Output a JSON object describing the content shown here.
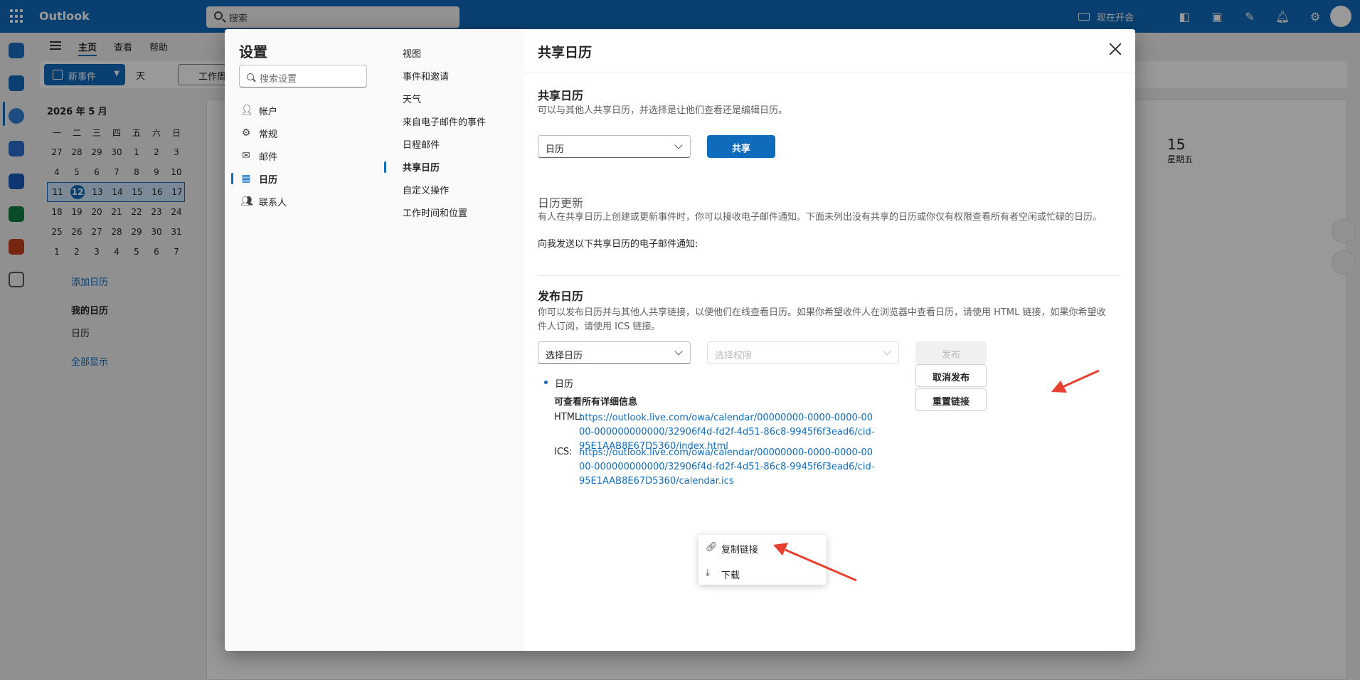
{
  "app": {
    "brand": "Outlook",
    "search_placeholder": "搜索",
    "meet_now": "现在开会"
  },
  "ribbon": {
    "tabs": [
      "主页",
      "查看",
      "帮助"
    ],
    "new_event": "新事件",
    "view_day": "天",
    "view_workweek": "工作周"
  },
  "mini_calendar": {
    "header": "2026 年 5 月",
    "weekdays": [
      "一",
      "二",
      "三",
      "四",
      "五",
      "六",
      "日"
    ],
    "weeks": [
      [
        "27",
        "28",
        "29",
        "30",
        "1",
        "2",
        "3"
      ],
      [
        "4",
        "5",
        "6",
        "7",
        "8",
        "9",
        "10"
      ],
      [
        "11",
        "12",
        "13",
        "14",
        "15",
        "16",
        "17"
      ],
      [
        "18",
        "19",
        "20",
        "21",
        "22",
        "23",
        "24"
      ],
      [
        "25",
        "26",
        "27",
        "28",
        "29",
        "30",
        "31"
      ],
      [
        "1",
        "2",
        "3",
        "4",
        "5",
        "6",
        "7"
      ]
    ],
    "selected_week_index": 2,
    "today": "12"
  },
  "left_pane": {
    "add_calendar": "添加日历",
    "my_calendars": "我的日历",
    "calendar_item": "日历",
    "show_all": "全部显示"
  },
  "calendar_view": {
    "col_day": "15",
    "col_weekday": "星期五"
  },
  "settings": {
    "title": "设置",
    "search_placeholder": "搜索设置",
    "categories": [
      {
        "label": "帐户",
        "icon": "person-icon"
      },
      {
        "label": "常规",
        "icon": "gear-icon"
      },
      {
        "label": "邮件",
        "icon": "mail-icon"
      },
      {
        "label": "日历",
        "icon": "calendar-icon",
        "active": true
      },
      {
        "label": "联系人",
        "icon": "people-icon"
      }
    ],
    "subcategories": [
      "视图",
      "事件和邀请",
      "天气",
      "来自电子邮件的事件",
      "日程邮件",
      "共享日历",
      "自定义操作",
      "工作时间和位置"
    ],
    "active_subcategory": "共享日历"
  },
  "content": {
    "header": "共享日历",
    "share_section": {
      "title": "共享日历",
      "description": "可以与其他人共享日历，并选择是让他们查看还是编辑日历。",
      "dropdown_value": "日历",
      "share_button": "共享"
    },
    "updates_section": {
      "title": "日历更新",
      "description": "有人在共享日历上创建或更新事件时，你可以接收电子邮件通知。下面未列出没有共享的日历或你仅有权限查看所有者空闲或忙碌的日历。",
      "notify_label": "向我发送以下共享日历的电子邮件通知:"
    },
    "publish_section": {
      "title": "发布日历",
      "description": "你可以发布日历并与其他人共享链接，以便他们在线查看日历。如果你希望收件人在浏览器中查看日历，请使用 HTML 链接，如果你希望收件人订阅，请使用 ICS 链接。",
      "select_calendar_placeholder": "选择日历",
      "select_permission_placeholder": "选择权限",
      "publish_button": "发布",
      "published_calendar": "日历",
      "permission": "可查看所有详细信息",
      "html_label": "HTML:",
      "html_link": "https://outlook.live.com/owa/calendar/00000000-0000-0000-0000-000000000000/32906f4d-fd2f-4d51-86c8-9945f6f3ead6/cid-95E1AAB8E67D5360/index.html",
      "ics_label": "ICS:",
      "ics_link": "https://outlook.live.com/owa/calendar/00000000-0000-0000-0000-000000000000/32906f4d-fd2f-4d51-86c8-9945f6f3ead6/cid-95E1AAB8E67D5360/calendar.ics",
      "unpublish_button": "取消发布",
      "reset_link_button": "重置链接"
    },
    "context_menu": {
      "items": [
        {
          "label": "复制链接",
          "icon": "link-icon"
        },
        {
          "label": "下载",
          "icon": "download-icon"
        }
      ]
    }
  },
  "colors": {
    "accent": "#0f6cbd",
    "annotation_arrow": "#e8402f"
  }
}
